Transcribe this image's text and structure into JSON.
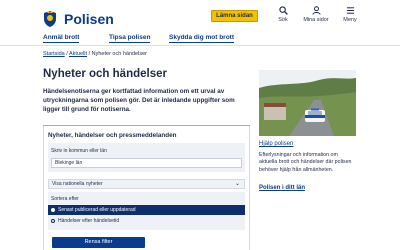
{
  "header": {
    "brand": "Polisen",
    "leave_button": "Lämna sidan",
    "search_label": "Sök",
    "my_pages_label": "Mina sidor",
    "menu_label": "Meny"
  },
  "nav": {
    "items": [
      {
        "label": "Anmäl brott"
      },
      {
        "label": "Tipsa polisen"
      },
      {
        "label": "Skydda dig mot brott"
      }
    ]
  },
  "breadcrumb": {
    "home": "Startsida",
    "sep1": " / ",
    "current_section": "Aktuellt",
    "sep2": " / ",
    "current_page": "Nyheter och händelser"
  },
  "main": {
    "title": "Nyheter och händelser",
    "lede": "Händelsenotiserna ger kortfattad information om ett urval av utryckningarna som polisen gör. Det är inledande uppgifter som ligger till grund för notiserna."
  },
  "filter": {
    "panel_title": "Nyheter, händelser och pressmeddelanden",
    "location_label": "Skriv in kommun eller län",
    "location_value": "Blekinge län",
    "national_select": "Visa nationella nyheter",
    "sort_label": "Sortera efter",
    "sort_options": [
      {
        "label": "Senast publicerad eller uppdaterad",
        "selected": true
      },
      {
        "label": "Händelser efter händelsetid",
        "selected": false
      }
    ],
    "submit_label": "Rensa filter"
  },
  "sidebar": {
    "help_link": "Hjälp polisen",
    "help_text": "Efterlysningar och information om aktuella brott och händelser där polisen behöver hjälp från allmänheten.",
    "local_link": "Polisen i ditt län"
  },
  "colors": {
    "brand_blue": "#0b3c8c",
    "leave_yellow": "#f2c200",
    "selected_row": "#0e2f6b"
  }
}
